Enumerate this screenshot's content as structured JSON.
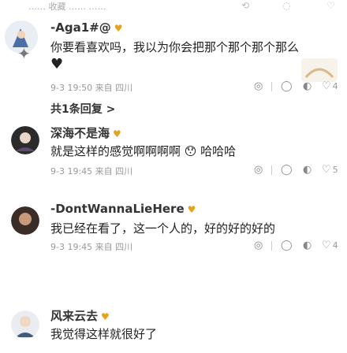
{
  "top": {
    "partial_text": "…… 收藏 …… ……"
  },
  "comments": [
    {
      "username": "-Aga1#@",
      "level_badge": "♥",
      "text": "你要看喜欢吗，我以为你会把那个那个那个那么",
      "text2": "♥",
      "time": "9-3 19:50",
      "meta_extra": "来自 四川",
      "like_count": "4",
      "replies_label": "共1条回复 >"
    },
    {
      "username": "深海不是海",
      "level_badge": "♥",
      "text": "就是这样的感觉啊啊啊啊 😯 哈哈哈",
      "time": "9-3 19:45",
      "meta_extra": "来自 四川",
      "like_count": "5"
    },
    {
      "username": "-DontWannaLieHere",
      "level_badge": "♥",
      "text": "我已经在看了，这一个人的，好的好的好的",
      "time": "9-3 19:45",
      "meta_extra": "来自 四川",
      "like_count": "4"
    },
    {
      "username": "风来云去",
      "level_badge": "♥",
      "text": "我觉得这样就很好了"
    }
  ],
  "colors": {
    "level": "#e4a31e",
    "meta": "#999999"
  },
  "icons": [
    "share-icon",
    "comment-icon",
    "dislike-icon",
    "like-icon"
  ]
}
